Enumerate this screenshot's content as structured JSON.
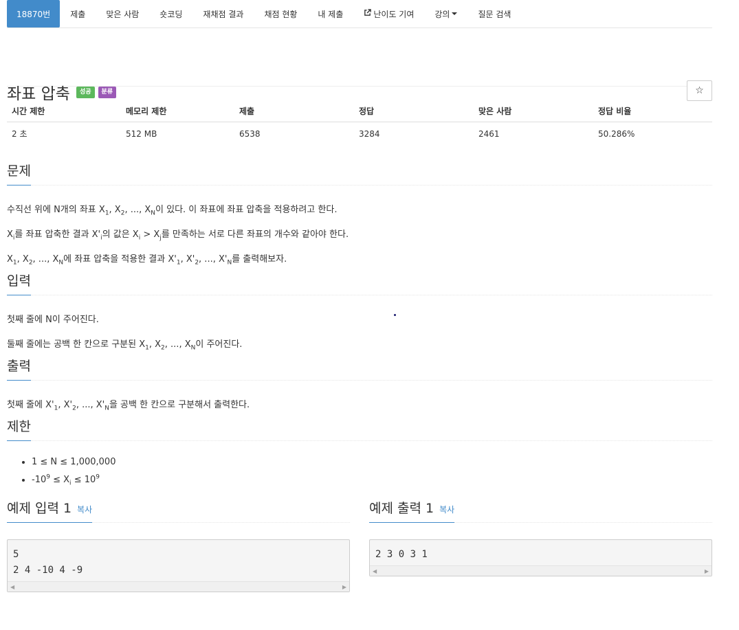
{
  "nav": {
    "items": [
      {
        "label": "18870번",
        "active": true
      },
      {
        "label": "제출"
      },
      {
        "label": "맞은 사람"
      },
      {
        "label": "숏코딩"
      },
      {
        "label": "재채점 결과"
      },
      {
        "label": "채점 현황"
      },
      {
        "label": "내 제출"
      },
      {
        "label": "난이도 기여",
        "icon": "external-link-icon"
      },
      {
        "label": "강의",
        "caret": true
      },
      {
        "label": "질문 검색"
      }
    ]
  },
  "problem": {
    "title": "좌표 압축",
    "badges": [
      {
        "label": "성공",
        "color": "#5cb85c"
      },
      {
        "label": "분류",
        "color": "#9b59b6"
      }
    ],
    "star_icon": "☆"
  },
  "info_table": {
    "headers": [
      "시간 제한",
      "메모리 제한",
      "제출",
      "정답",
      "맞은 사람",
      "정답 비율"
    ],
    "values": [
      "2 초",
      "512 MB",
      "6538",
      "3284",
      "2461",
      "50.286%"
    ]
  },
  "sections": {
    "description_title": "문제",
    "input_title": "입력",
    "output_title": "출력",
    "limit_title": "제한"
  },
  "description": {
    "line1": {
      "a": "수직선 위에 N개의 좌표 X",
      "b": "1",
      "c": ", X",
      "d": "2",
      "e": ", ..., X",
      "f": "N",
      "g": "이 있다. 이 좌표에 좌표 압축을 적용하려고 한다."
    },
    "line2": {
      "a": "X",
      "b": "i",
      "c": "를 좌표 압축한 결과 X'",
      "d": "i",
      "e": "의 값은 X",
      "f": "i",
      "g": " > X",
      "h": "j",
      "i2": "를 만족하는 서로 다른 좌표의 개수와 같아야 한다."
    },
    "line3": {
      "a": "X",
      "b": "1",
      "c": ", X",
      "d": "2",
      "e": ", ..., X",
      "f": "N",
      "g": "에 좌표 압축을 적용한 결과 X'",
      "h": "1",
      "i2": ", X'",
      "j": "2",
      "k": ", ..., X'",
      "l": "N",
      "m": "를 출력해보자."
    }
  },
  "input": {
    "line1": "첫째 줄에 N이 주어진다.",
    "line2": {
      "a": "둘째 줄에는 공백 한 칸으로 구분된 X",
      "b": "1",
      "c": ", X",
      "d": "2",
      "e": ", ..., X",
      "f": "N",
      "g": "이 주어진다."
    }
  },
  "output": {
    "line1": {
      "a": "첫째 줄에 X'",
      "b": "1",
      "c": ", X'",
      "d": "2",
      "e": ", ..., X'",
      "f": "N",
      "g": "을 공백 한 칸으로 구분해서 출력한다."
    }
  },
  "limits": {
    "item1": "1 ≤ N ≤ 1,000,000",
    "item2": {
      "a": "-10",
      "b": "9",
      "c": " ≤ X",
      "d": "i",
      "e": " ≤ 10",
      "f": "9"
    }
  },
  "examples": {
    "copy_label": "복사",
    "input_title": "예제 입력 1",
    "input_text": "5\n2 4 -10 4 -9",
    "output_title": "예제 출력 1",
    "output_text": "2 3 0 3 1"
  }
}
